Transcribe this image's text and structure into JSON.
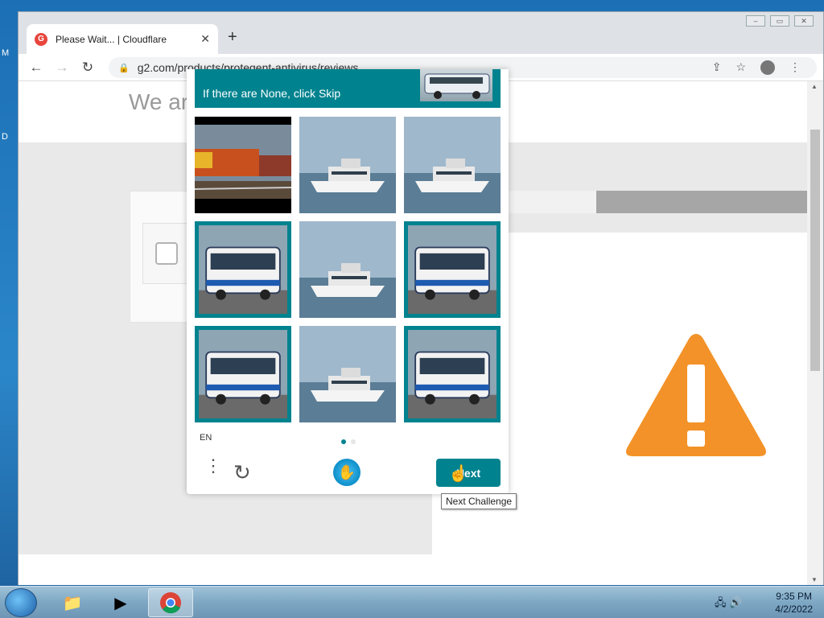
{
  "desktop": {
    "left_glyphs": [
      "M",
      "D"
    ]
  },
  "browser": {
    "tab_title": "Please Wait... | Cloudflare",
    "tab_favicon": "G",
    "new_tab": "+",
    "url": "g2.com/products/protegent-antivirus/reviews"
  },
  "page": {
    "banner_text": "We ar                                                       g2.com"
  },
  "captcha": {
    "prompt": "If there are None, click Skip",
    "lang": "EN",
    "next_label": "Next",
    "tiles": [
      {
        "subject": "train",
        "selected": false
      },
      {
        "subject": "boat",
        "selected": false
      },
      {
        "subject": "boat",
        "selected": false
      },
      {
        "subject": "bus",
        "selected": true
      },
      {
        "subject": "boat",
        "selected": false
      },
      {
        "subject": "bus",
        "selected": true
      },
      {
        "subject": "bus",
        "selected": true
      },
      {
        "subject": "boat",
        "selected": false
      },
      {
        "subject": "bus",
        "selected": true
      }
    ]
  },
  "tooltip": "Next Challenge",
  "taskbar": {
    "time": "9:35 PM",
    "date": "4/2/2022"
  },
  "colors": {
    "accent": "#00838f",
    "warning": "#f39228"
  }
}
